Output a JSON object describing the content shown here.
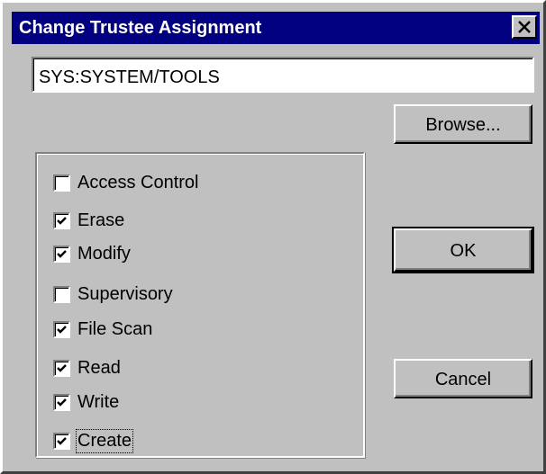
{
  "window": {
    "title": "Change Trustee Assignment",
    "close_icon": "close-icon"
  },
  "path": {
    "value": "SYS:SYSTEM/TOOLS"
  },
  "buttons": {
    "browse_label": "Browse...",
    "ok_label": "OK",
    "cancel_label": "Cancel"
  },
  "rights": [
    {
      "label": "Access Control",
      "checked": false
    },
    {
      "label": "Erase",
      "checked": true
    },
    {
      "label": "Modify",
      "checked": true
    },
    {
      "label": "Supervisory",
      "checked": false
    },
    {
      "label": "File Scan",
      "checked": true
    },
    {
      "label": "Read",
      "checked": true
    },
    {
      "label": "Write",
      "checked": true
    },
    {
      "label": "Create",
      "checked": true,
      "focused": true
    }
  ],
  "colors": {
    "titlebar": "#000080",
    "face": "#c0c0c0"
  }
}
